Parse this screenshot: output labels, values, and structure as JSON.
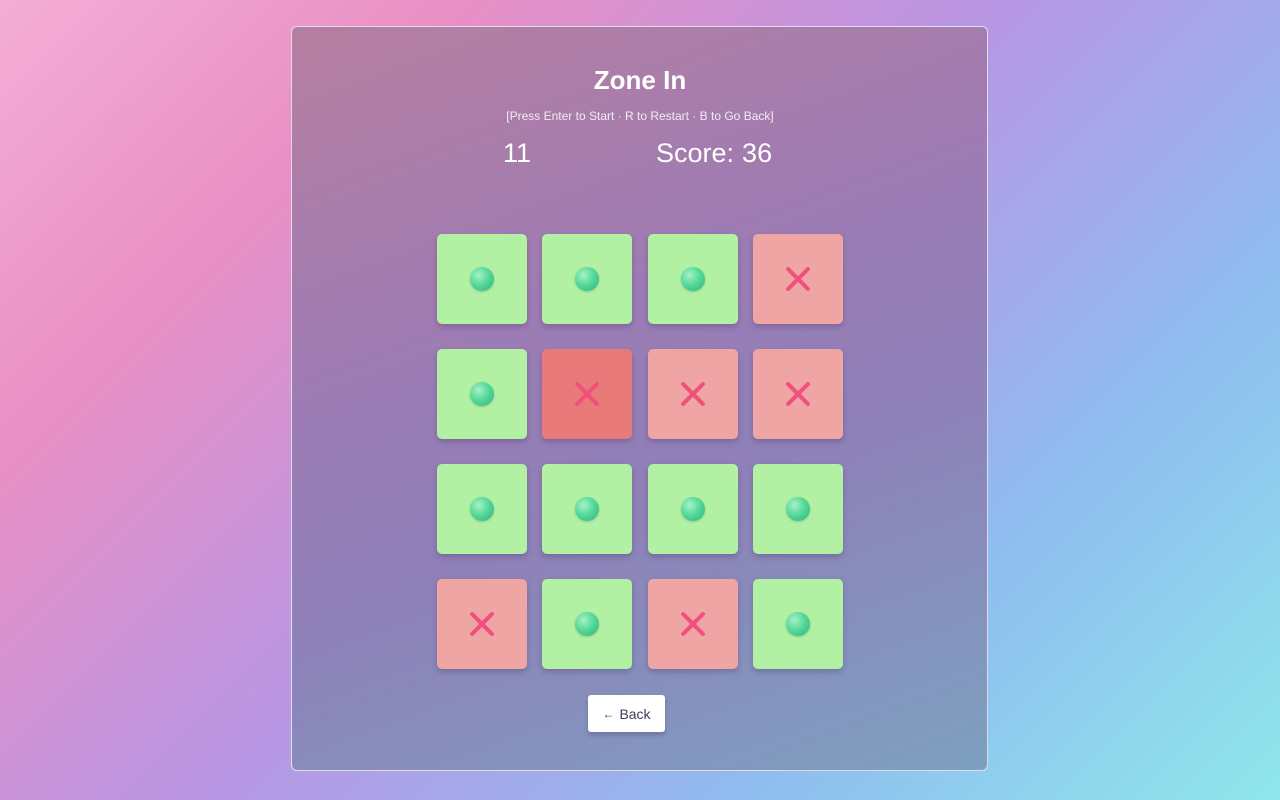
{
  "game": {
    "title": "Zone In",
    "instructions": "[Press Enter to Start · R to Restart · B to Go Back]",
    "timer": "11",
    "score_label": "Score:",
    "score_value": "36"
  },
  "board": {
    "rows": [
      [
        {
          "type": "safe"
        },
        {
          "type": "safe"
        },
        {
          "type": "safe"
        },
        {
          "type": "danger"
        }
      ],
      [
        {
          "type": "safe"
        },
        {
          "type": "danger",
          "active": true
        },
        {
          "type": "danger"
        },
        {
          "type": "danger"
        }
      ],
      [
        {
          "type": "safe"
        },
        {
          "type": "safe"
        },
        {
          "type": "safe"
        },
        {
          "type": "safe"
        }
      ],
      [
        {
          "type": "danger"
        },
        {
          "type": "safe"
        },
        {
          "type": "danger"
        },
        {
          "type": "safe"
        }
      ]
    ],
    "icons": {
      "safe": "green-orb-icon",
      "danger": "red-x-icon"
    }
  },
  "colors": {
    "safe_tile": "#b2f0a4",
    "danger_tile": "#efa5a3",
    "danger_tile_active": "#e87b7a",
    "orb": "#57d99a",
    "cross": "#f0507c"
  },
  "back_button": {
    "arrow": "←",
    "label": "Back"
  }
}
